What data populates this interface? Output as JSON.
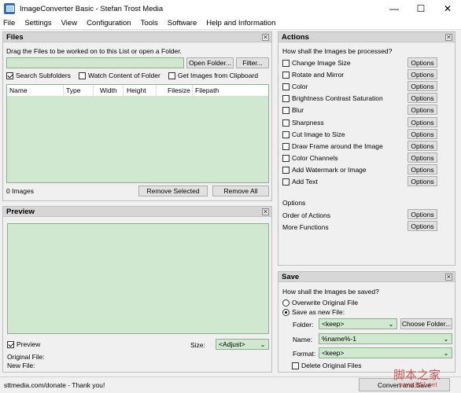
{
  "window": {
    "title": "ImageConverter Basic - Stefan Trost Media"
  },
  "menu": [
    "File",
    "Settings",
    "View",
    "Configuration",
    "Tools",
    "Software",
    "Help and Information"
  ],
  "files": {
    "header": "Files",
    "instruction": "Drag the Files to be worked on to this List or open a Folder.",
    "path_value": "",
    "open_folder": "Open Folder...",
    "filter": "Filter...",
    "search_subfolders": "Search Subfolders",
    "watch_content": "Watch Content of Folder",
    "get_clipboard": "Get Images from Clipboard",
    "columns": [
      "Name",
      "Type",
      "Width",
      "Height",
      "Filesize",
      "Filepath"
    ],
    "count": "0 Images",
    "remove_selected": "Remove Selected",
    "remove_all": "Remove All"
  },
  "preview": {
    "header": "Preview",
    "checkbox": "Preview",
    "size_label": "Size:",
    "size_value": "<Adjust>",
    "original_file": "Original File:",
    "new_file": "New File:"
  },
  "actions": {
    "header": "Actions",
    "question": "How shall the Images be processed?",
    "items": [
      "Change Image Size",
      "Rotate and Mirror",
      "Color",
      "Brightness Contrast Saturation",
      "Blur",
      "Sharpness",
      "Cut Image to Size",
      "Draw Frame around the Image",
      "Color Channels",
      "Add Watermark or Image",
      "Add Text"
    ],
    "options_label": "Options",
    "section_options": "Options",
    "order_of_actions": "Order of Actions",
    "more_functions": "More Functions"
  },
  "save": {
    "header": "Save",
    "question": "How shall the Images be saved?",
    "overwrite": "Overwrite Original File",
    "save_new": "Save as new File:",
    "folder_label": "Folder:",
    "folder_value": "<keep>",
    "choose_folder": "Choose Folder...",
    "name_label": "Name:",
    "name_value": "%name%-1",
    "format_label": "Format:",
    "format_value": "<keep>",
    "delete_original": "Delete Original Files"
  },
  "status": {
    "text": "sttmedia.com/donate - Thank you!",
    "convert": "Convert and Save",
    "watermark": "脚本之家",
    "watermark_url": "www.jb51.net"
  }
}
